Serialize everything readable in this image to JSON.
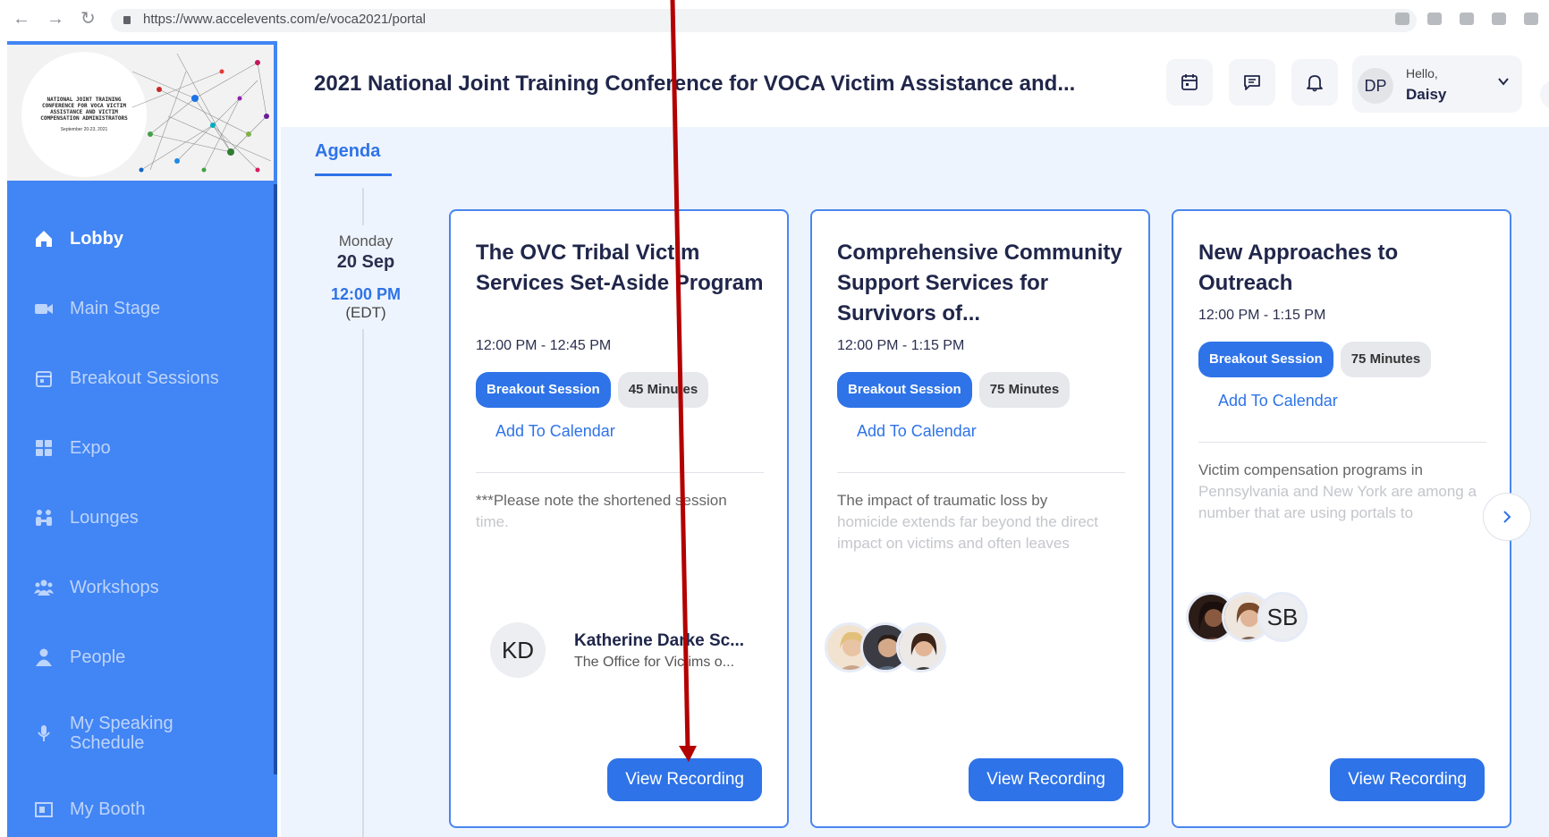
{
  "browser": {
    "url": "https://www.accelevents.com/e/voca2021/portal"
  },
  "sidebar": {
    "logo": {
      "text": "NATIONAL JOINT TRAINING CONFERENCE FOR VOCA VICTIM ASSISTANCE AND VICTIM COMPENSATION ADMINISTRATORS",
      "date": "September 20-23, 2021"
    },
    "items": [
      {
        "label": "Lobby",
        "icon": "home-icon",
        "active": true
      },
      {
        "label": "Main Stage",
        "icon": "video-camera-icon",
        "active": false
      },
      {
        "label": "Breakout Sessions",
        "icon": "calendar-icon",
        "active": false
      },
      {
        "label": "Expo",
        "icon": "grid-icon",
        "active": false
      },
      {
        "label": "Lounges",
        "icon": "lounge-icon",
        "active": false
      },
      {
        "label": "Workshops",
        "icon": "group-icon",
        "active": false
      },
      {
        "label": "People",
        "icon": "person-icon",
        "active": false
      },
      {
        "label": "My Speaking Schedule",
        "icon": "microphone-icon",
        "active": false
      },
      {
        "label": "My Booth",
        "icon": "booth-icon",
        "active": false
      }
    ]
  },
  "header": {
    "title": "2021 National Joint Training Conference for VOCA Victim Assistance and...",
    "user": {
      "initials": "DP",
      "greeting": "Hello,",
      "name": "Daisy"
    }
  },
  "tabs": {
    "agenda": "Agenda"
  },
  "timeline": {
    "day_name": "Monday",
    "day_date": "20 Sep",
    "time": "12:00 PM",
    "timezone": "(EDT)"
  },
  "sessions": [
    {
      "title": "The OVC Tribal Victim Services Set-Aside Program",
      "time": "12:00 PM - 12:45 PM",
      "type": "Breakout Session",
      "duration": "45 Minutes",
      "add_calendar": "Add To Calendar",
      "description": "***Please note the shortened session",
      "description_fade": "time.",
      "speaker_initials": "KD",
      "speaker_name": "Katherine Darke Sc...",
      "speaker_org": "The Office for Victims o...",
      "button": "View Recording"
    },
    {
      "title": "Comprehensive Community Support Services for Survivors of...",
      "time": "12:00 PM - 1:15 PM",
      "type": "Breakout Session",
      "duration": "75 Minutes",
      "add_calendar": "Add To Calendar",
      "description": "The impact of traumatic loss by",
      "description_fade": "homicide extends far beyond the direct impact on victims and often leaves",
      "button": "View Recording"
    },
    {
      "title": "New Approaches to Outreach",
      "time": "12:00 PM - 1:15 PM",
      "type": "Breakout Session",
      "duration": "75 Minutes",
      "add_calendar": "Add To Calendar",
      "description": "Victim compensation programs in",
      "description_fade": "Pennsylvania and New York are among a number that are using portals to",
      "speaker_initials": "SB",
      "button": "View Recording"
    }
  ],
  "colors": {
    "sidebar": "#4285f4",
    "accent": "#2e73e8",
    "annotation_arrow": "#b30000"
  }
}
